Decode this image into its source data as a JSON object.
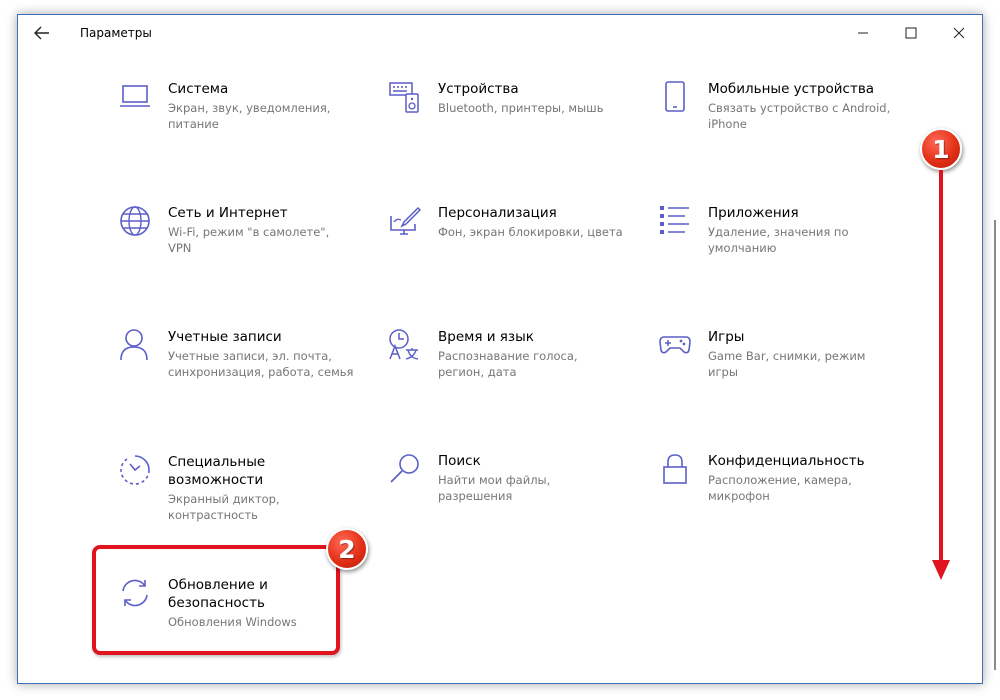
{
  "window": {
    "title": "Параметры",
    "back_icon": "arrow-left-icon",
    "controls": [
      "minimize-icon",
      "maximize-icon",
      "close-icon"
    ]
  },
  "tiles": [
    {
      "title": "Система",
      "desc": "Экран, звук, уведомления,\nпитание",
      "icon": "laptop-icon"
    },
    {
      "title": "Устройства",
      "desc": "Bluetooth, принтеры, мышь",
      "icon": "keyboard-icon"
    },
    {
      "title": "Мобильные устройства",
      "desc": "Связать устройство с Android,\niPhone",
      "icon": "phone-icon"
    },
    {
      "title": "Сеть и Интернет",
      "desc": "Wi-Fi, режим \"в самолете\",\nVPN",
      "icon": "globe-icon"
    },
    {
      "title": "Персонализация",
      "desc": "Фон, экран блокировки, цвета",
      "icon": "paint-icon"
    },
    {
      "title": "Приложения",
      "desc": "Удаление, значения по\nумолчанию",
      "icon": "apps-list-icon"
    },
    {
      "title": "Учетные записи",
      "desc": "Учетные записи, эл. почта,\nсинхронизация, работа, семья",
      "icon": "person-icon"
    },
    {
      "title": "Время и язык",
      "desc": "Распознавание голоса,\nрегион, дата",
      "icon": "time-language-icon"
    },
    {
      "title": "Игры",
      "desc": "Game Bar, снимки, режим\nигры",
      "icon": "gamepad-icon"
    },
    {
      "title": "Специальные\nвозможности",
      "desc": "Экранный диктор,\nконтрастность",
      "icon": "accessibility-icon"
    },
    {
      "title": "Поиск",
      "desc": "Найти мои файлы,\nразрешения",
      "icon": "search-icon"
    },
    {
      "title": "Конфиденциальность",
      "desc": "Расположение, камера,\nмикрофон",
      "icon": "lock-icon"
    },
    {
      "title": "Обновление и\nбезопасность",
      "desc": "Обновления Windows",
      "icon": "sync-icon"
    }
  ],
  "annotations": {
    "badge_1": "1",
    "badge_2": "2",
    "accent_color": "#e0141e",
    "icon_color": "#5b5fc7"
  }
}
